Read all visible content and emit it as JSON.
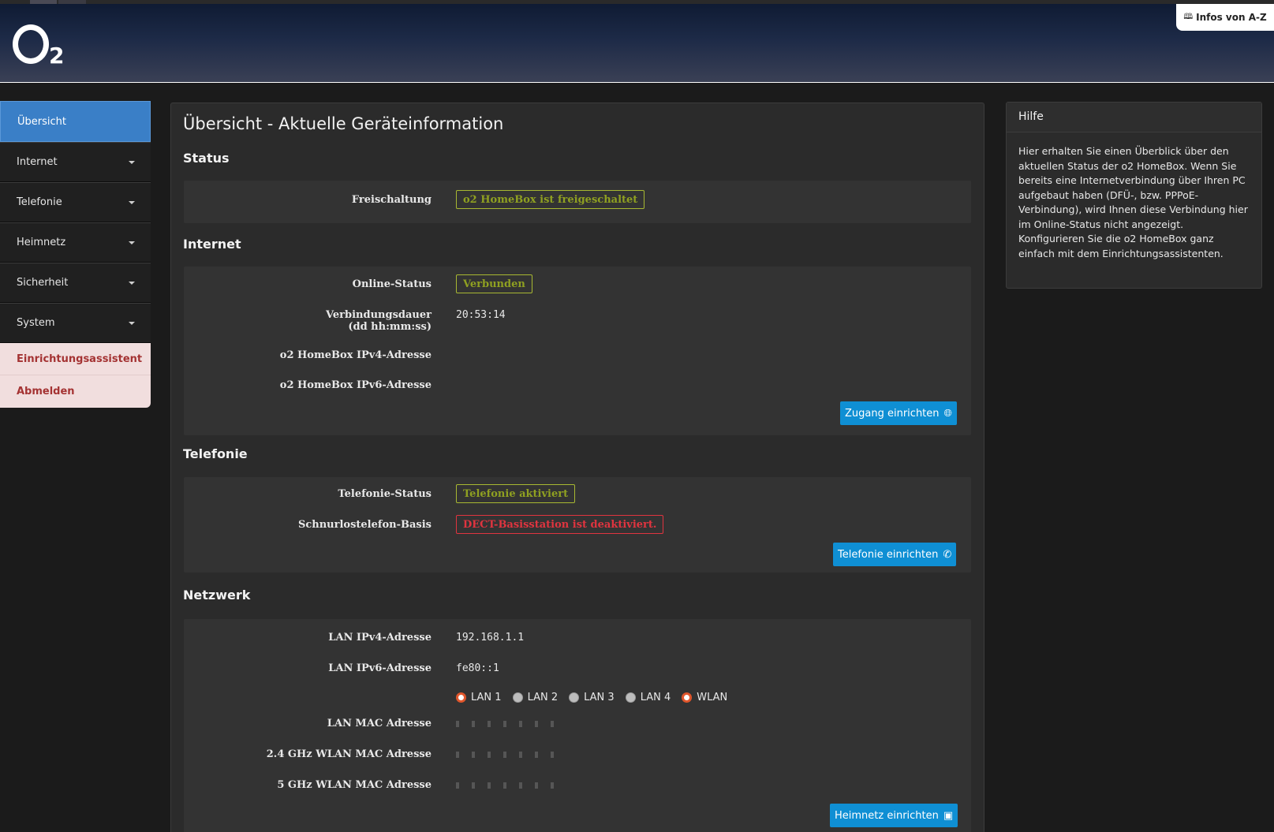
{
  "header": {
    "logo_text": "O2",
    "az_button_label": "Infos von A-Z"
  },
  "sidebar": {
    "items": [
      {
        "label": "Übersicht",
        "active": true,
        "has_caret": false
      },
      {
        "label": "Internet",
        "has_caret": true
      },
      {
        "label": "Telefonie",
        "has_caret": true
      },
      {
        "label": "Heimnetz",
        "has_caret": true
      },
      {
        "label": "Sicherheit",
        "has_caret": true
      },
      {
        "label": "System",
        "has_caret": true
      }
    ],
    "wizard_label": "Einrichtungsassistent",
    "logout_label": "Abmelden"
  },
  "main": {
    "title": "Übersicht - Aktuelle Geräteinformation",
    "status": {
      "heading": "Status",
      "activation_label": "Freischaltung",
      "activation_value": "o2 HomeBox ist freigeschaltet"
    },
    "internet": {
      "heading": "Internet",
      "online_label": "Online-Status",
      "online_value": "Verbunden",
      "duration_label": "Verbindungsdauer",
      "duration_sublabel": "(dd hh:mm:ss)",
      "duration_value": "20:53:14",
      "ipv4_label": "o2 HomeBox IPv4-Adresse",
      "ipv6_label": "o2 HomeBox IPv6-Adresse",
      "button_label": "Zugang einrichten"
    },
    "telefonie": {
      "heading": "Telefonie",
      "status_label": "Telefonie-Status",
      "status_value": "Telefonie aktiviert",
      "dect_label": "Schnurlostelefon-Basis",
      "dect_value": "DECT-Basisstation ist deaktiviert.",
      "button_label": "Telefonie einrichten"
    },
    "netzwerk": {
      "heading": "Netzwerk",
      "lan_ipv4_label": "LAN IPv4-Adresse",
      "lan_ipv4_value": "192.168.1.1",
      "lan_ipv6_label": "LAN IPv6-Adresse",
      "lan_ipv6_value": "fe80::1",
      "ports": [
        {
          "label": "LAN 1",
          "active": true
        },
        {
          "label": "LAN 2",
          "active": false
        },
        {
          "label": "LAN 3",
          "active": false
        },
        {
          "label": "LAN 4",
          "active": false
        },
        {
          "label": "WLAN",
          "active": true
        }
      ],
      "lan_mac_label": "LAN MAC Adresse",
      "wlan24_mac_label": "2.4 GHz WLAN MAC Adresse",
      "wlan5_mac_label": "5 GHz WLAN MAC Adresse",
      "button_label": "Heimnetz einrichten"
    }
  },
  "help": {
    "heading": "Hilfe",
    "text": "Hier erhalten Sie einen Überblick über den aktuellen Status der o2 HomeBox. Wenn Sie bereits eine Internetverbindung über Ihren PC aufgebaut haben (DFÜ-, bzw. PPPoE-Verbindung), wird Ihnen diese Verbindung hier im Online-Status nicht angezeigt. Konfigurieren Sie die o2 HomeBox ganz einfach mit dem Einrichtungsassistenten."
  },
  "colors": {
    "accent_blue": "#0f8fd4",
    "active_nav": "#3a7fc7",
    "ok_green": "#8fa021",
    "error_red": "#e0343f",
    "special_nav_bg": "#f1dede",
    "special_nav_text": "#a43333"
  },
  "icons": {
    "az_button": "book-icon",
    "zugang_button": "globe-icon",
    "telefonie_button": "phone-icon",
    "heimnetz_button": "network-icon"
  }
}
